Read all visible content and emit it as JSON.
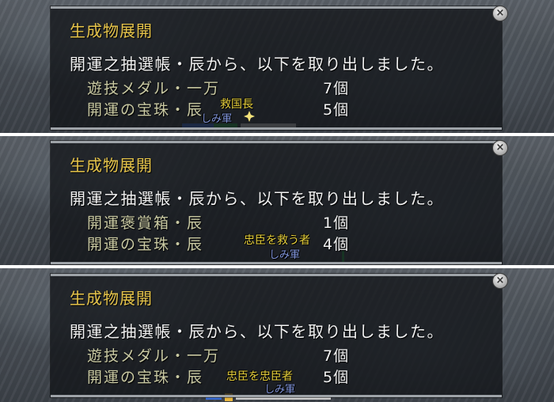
{
  "dialogs": [
    {
      "title": "生成物展開",
      "message": "開運之抽選帳・辰から、以下を取り出しました。",
      "items": [
        {
          "name": "遊技メダル・一万",
          "qty": "7個"
        },
        {
          "name": "開運の宝珠・辰",
          "qty": "5個"
        }
      ],
      "close_symbol": "×",
      "overlay_name": "救国長",
      "overlay_sub": "しみ軍"
    },
    {
      "title": "生成物展開",
      "message": "開運之抽選帳・辰から、以下を取り出しました。",
      "items": [
        {
          "name": "開運褒賞箱・辰",
          "qty": "1個"
        },
        {
          "name": "開運の宝珠・辰",
          "qty": "4個"
        }
      ],
      "close_symbol": "×",
      "overlay_name": "忠臣を救う者",
      "overlay_sub": "しみ軍"
    },
    {
      "title": "生成物展開",
      "message": "開運之抽選帳・辰から、以下を取り出しました。",
      "items": [
        {
          "name": "遊技メダル・一万",
          "qty": "7個"
        },
        {
          "name": "開運の宝珠・辰",
          "qty": "5個"
        }
      ],
      "close_symbol": "×",
      "overlay_name": "忠臣を忠臣者",
      "overlay_sub": "しみ軍"
    }
  ]
}
